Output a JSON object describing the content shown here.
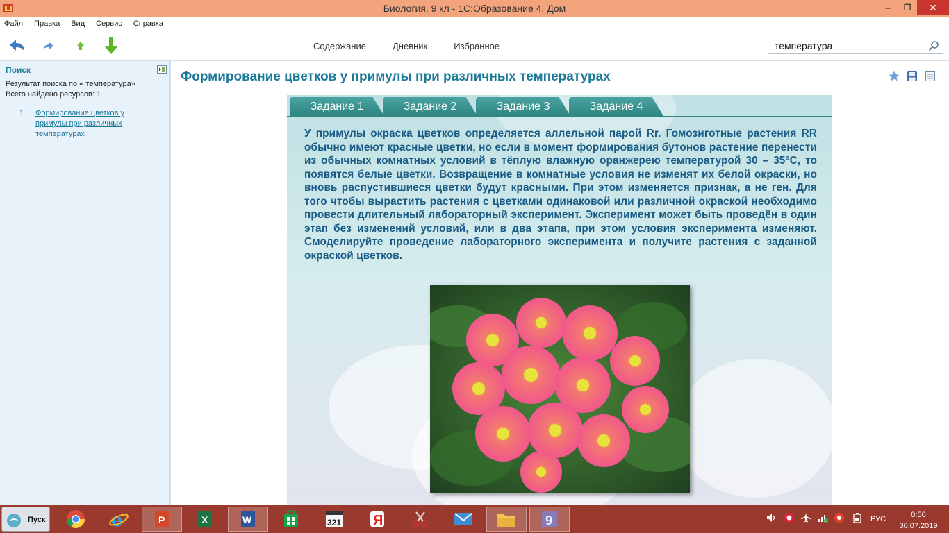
{
  "window": {
    "title": "Биология, 9 кл - 1С:Образование 4. Дом",
    "minimize": "‒",
    "restore": "❐",
    "close": "✕"
  },
  "menu": {
    "items": [
      "Файл",
      "Правка",
      "Вид",
      "Сервис",
      "Справка"
    ]
  },
  "nav": {
    "items": [
      "Содержание",
      "Дневник",
      "Избранное"
    ]
  },
  "search": {
    "value": "температура"
  },
  "left_panel": {
    "title": "Поиск",
    "result_label": "Результат поиска по « температура»",
    "count_label": "Всего найдено ресурсов: 1",
    "results": [
      {
        "num": "1.",
        "label": "Формирование цветков у примулы при различных температурах"
      }
    ]
  },
  "main": {
    "title": "Формирование цветков у примулы при различных температурах",
    "tabs": [
      "Задание 1",
      "Задание 2",
      "Задание 3",
      "Задание 4"
    ],
    "task_text": "У примулы окраска цветков определяется аллельной парой Rr. Гомозиготные растения RR обычно имеют красные цветки, но если в момент формирования бутонов растение перенести из обычных комнатных условий в тёплую влажную оранжерею температурой 30 – 35°С, то появятся белые цветки. Возвращение в комнатные условия не изменят их белой окраски, но вновь распустившиеся цветки будут красными. При этом изменяется признак, а не ген. Для того чтобы вырастить растения с цветками одинаковой или различной окраской необходимо провести длительный лабораторный эксперимент. Эксперимент может быть проведён в один этап без изменений условий, или в два этапа, при этом условия эксперимента изменяют. Смоделируйте проведение лабораторного эксперимента и получите растения с заданной окраской цветков."
  },
  "taskbar": {
    "start_label": "Пуск",
    "apps": [
      "chrome-icon",
      "internet-explorer-icon",
      "powerpoint-icon",
      "excel-icon",
      "word-icon",
      "store-icon",
      "media-player-icon",
      "yandex-icon",
      "scissors-icon",
      "mail-icon",
      "file-explorer-icon",
      "education-app-icon"
    ],
    "language": "РУС",
    "time": "0:50",
    "date": "30.07.2019"
  }
}
